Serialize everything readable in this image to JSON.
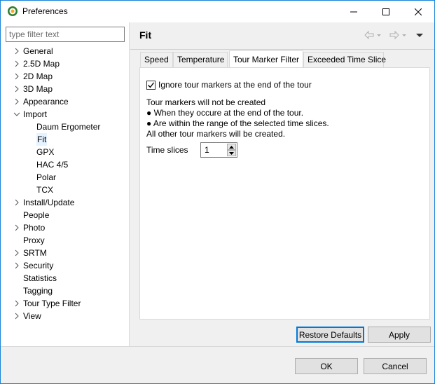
{
  "window": {
    "title": "Preferences"
  },
  "filter": {
    "placeholder": "type filter text",
    "value": ""
  },
  "tree": {
    "items": [
      {
        "label": "General",
        "level": 0,
        "expandable": true,
        "expanded": false
      },
      {
        "label": "2.5D Map",
        "level": 0,
        "expandable": true,
        "expanded": false
      },
      {
        "label": "2D Map",
        "level": 0,
        "expandable": true,
        "expanded": false
      },
      {
        "label": "3D Map",
        "level": 0,
        "expandable": true,
        "expanded": false
      },
      {
        "label": "Appearance",
        "level": 0,
        "expandable": true,
        "expanded": false
      },
      {
        "label": "Import",
        "level": 0,
        "expandable": true,
        "expanded": true
      },
      {
        "label": "Daum Ergometer",
        "level": 1,
        "expandable": false
      },
      {
        "label": "Fit",
        "level": 1,
        "expandable": false,
        "selected": true
      },
      {
        "label": "GPX",
        "level": 1,
        "expandable": false
      },
      {
        "label": "HAC 4/5",
        "level": 1,
        "expandable": false
      },
      {
        "label": "Polar",
        "level": 1,
        "expandable": false
      },
      {
        "label": "TCX",
        "level": 1,
        "expandable": false
      },
      {
        "label": "Install/Update",
        "level": 0,
        "expandable": true,
        "expanded": false
      },
      {
        "label": "People",
        "level": 0,
        "expandable": false
      },
      {
        "label": "Photo",
        "level": 0,
        "expandable": true,
        "expanded": false
      },
      {
        "label": "Proxy",
        "level": 0,
        "expandable": false
      },
      {
        "label": "SRTM",
        "level": 0,
        "expandable": true,
        "expanded": false
      },
      {
        "label": "Security",
        "level": 0,
        "expandable": true,
        "expanded": false
      },
      {
        "label": "Statistics",
        "level": 0,
        "expandable": false
      },
      {
        "label": "Tagging",
        "level": 0,
        "expandable": false
      },
      {
        "label": "Tour Type Filter",
        "level": 0,
        "expandable": true,
        "expanded": false
      },
      {
        "label": "View",
        "level": 0,
        "expandable": true,
        "expanded": false
      }
    ]
  },
  "page": {
    "title": "Fit",
    "tabs": [
      {
        "label": "Speed",
        "active": false
      },
      {
        "label": "Temperature",
        "active": false
      },
      {
        "label": "Tour Marker Filter",
        "active": true
      },
      {
        "label": "Exceeded Time Slice",
        "active": false
      }
    ],
    "ignore_markers": {
      "label": "Ignore tour markers at the end of the tour",
      "checked": true
    },
    "description": [
      "Tour markers will not be created",
      "● When they occure at the end of the tour.",
      "● Are within the range of the selected time slices.",
      "All other tour markers will be created."
    ],
    "time_slices": {
      "label": "Time slices",
      "value": "1"
    },
    "restore_label": "Restore Defaults",
    "apply_label": "Apply"
  },
  "dialog": {
    "ok_label": "OK",
    "cancel_label": "Cancel"
  },
  "colors": {
    "accent": "#0078d7",
    "selection": "#e5f3ff",
    "window_border": "#1883d7"
  }
}
